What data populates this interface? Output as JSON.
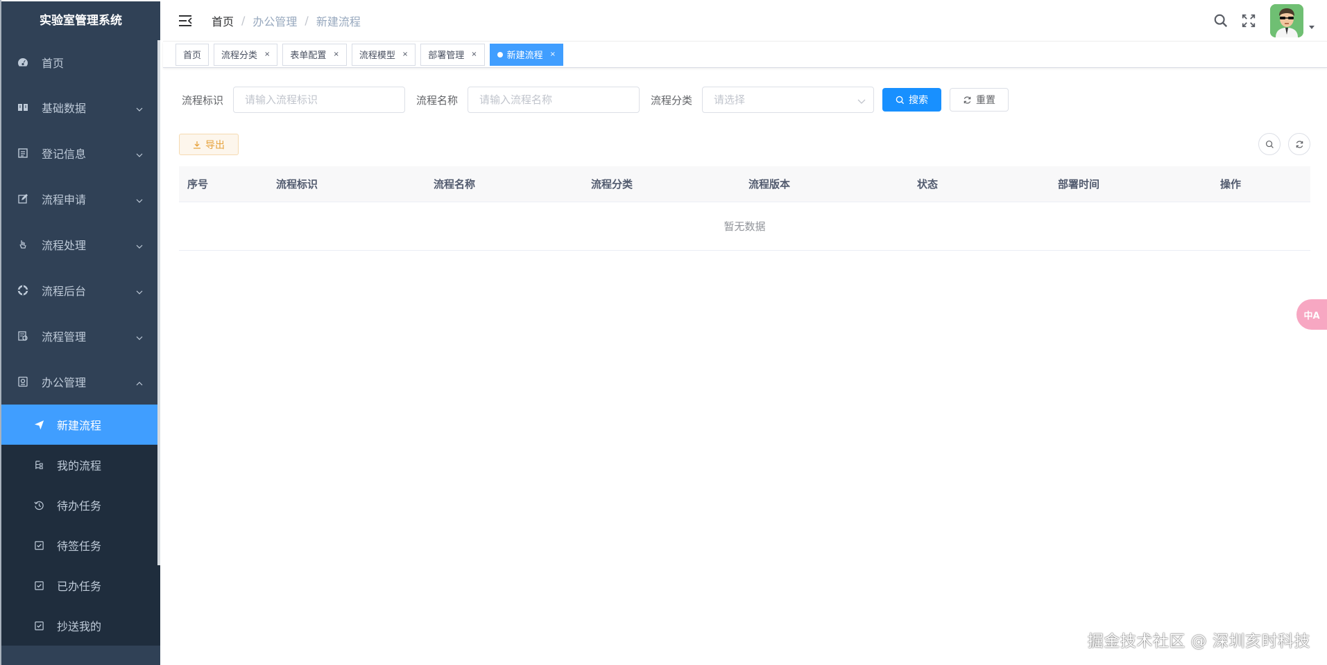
{
  "sidebar": {
    "logo": "实验室管理系统",
    "menu": [
      {
        "label": "首页",
        "icon": "dashboard-icon"
      },
      {
        "label": "基础数据",
        "icon": "book-icon"
      },
      {
        "label": "登记信息",
        "icon": "register-icon"
      },
      {
        "label": "流程申请",
        "icon": "edit-icon"
      },
      {
        "label": "流程处理",
        "icon": "hand-icon"
      },
      {
        "label": "流程后台",
        "icon": "lifebuoy-icon"
      },
      {
        "label": "流程管理",
        "icon": "manage-icon"
      },
      {
        "label": "办公管理",
        "icon": "office-icon"
      }
    ],
    "submenu": [
      {
        "label": "新建流程",
        "icon": "send-icon"
      },
      {
        "label": "我的流程",
        "icon": "tree-icon"
      },
      {
        "label": "待办任务",
        "icon": "history-icon"
      },
      {
        "label": "待签任务",
        "icon": "checkbox-icon"
      },
      {
        "label": "已办任务",
        "icon": "checkbox-icon"
      },
      {
        "label": "抄送我的",
        "icon": "checkbox-icon"
      }
    ]
  },
  "breadcrumb": [
    "首页",
    "办公管理",
    "新建流程"
  ],
  "breadcrumb_separator": "/",
  "tags": [
    {
      "label": "首页",
      "closable": false
    },
    {
      "label": "流程分类",
      "closable": true
    },
    {
      "label": "表单配置",
      "closable": true
    },
    {
      "label": "流程模型",
      "closable": true
    },
    {
      "label": "部署管理",
      "closable": true
    },
    {
      "label": "新建流程",
      "closable": true,
      "active": true
    }
  ],
  "tag_close_glyph": "×",
  "search": {
    "key_label": "流程标识",
    "key_placeholder": "请输入流程标识",
    "name_label": "流程名称",
    "name_placeholder": "请输入流程名称",
    "category_label": "流程分类",
    "category_placeholder": "请选择",
    "search_button": "搜索",
    "reset_button": "重置"
  },
  "toolbar": {
    "export_button": "导出"
  },
  "table": {
    "columns": [
      "序号",
      "流程标识",
      "流程名称",
      "流程分类",
      "流程版本",
      "状态",
      "部署时间",
      "操作"
    ],
    "rows": [],
    "empty_text": "暂无数据"
  },
  "translate_badge": "中A",
  "watermark": "掘金技术社区 @ 深圳亥时科技",
  "colors": {
    "sidebar_bg": "#304156",
    "submenu_bg": "#1f2d3d",
    "accent": "#409eff",
    "primary_button": "#1890ff",
    "warning": "#e6a23c"
  }
}
